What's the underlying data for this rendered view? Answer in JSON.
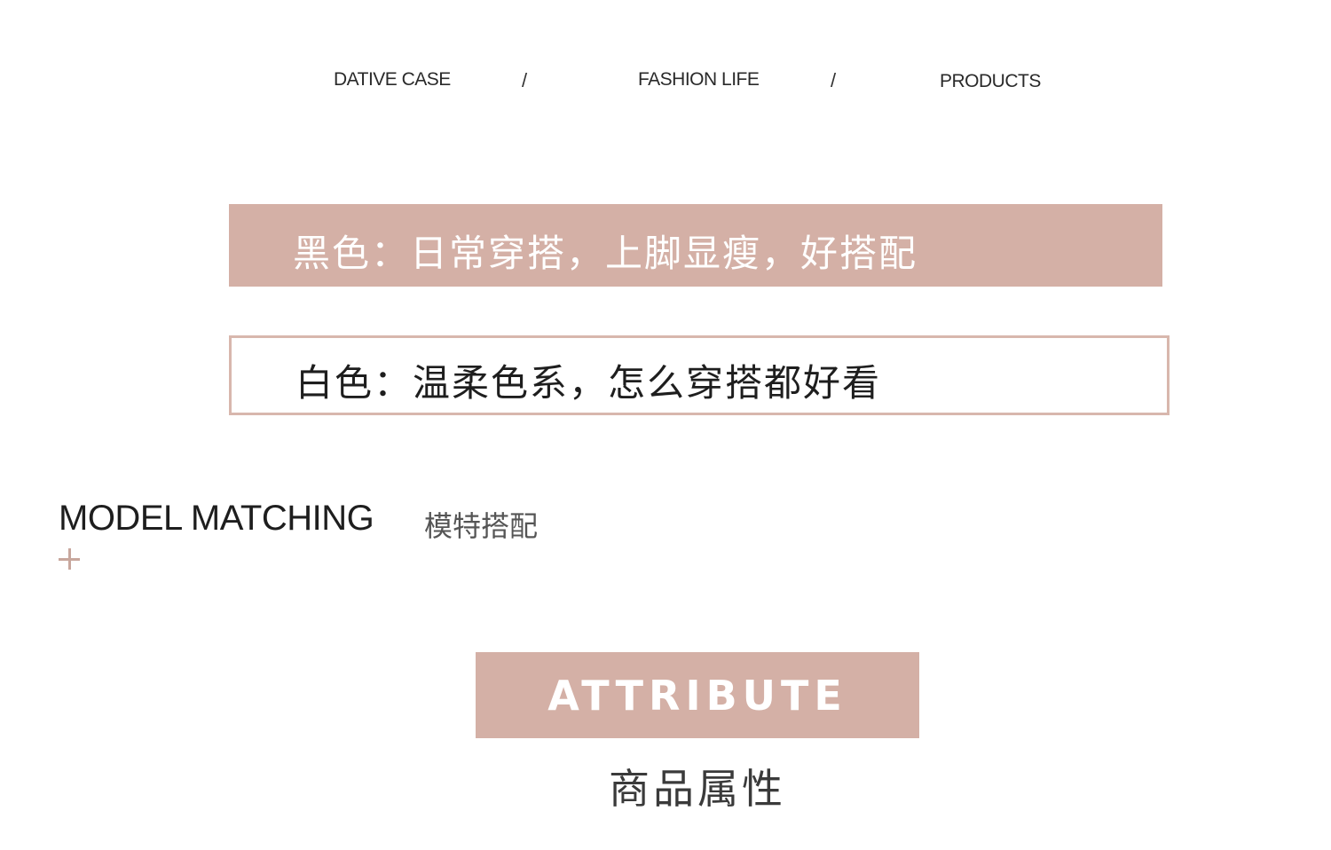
{
  "nav": {
    "items": [
      "DATIVE CASE",
      "FASHION LIFE",
      "PRODUCTS"
    ],
    "separator": "/"
  },
  "banners": {
    "black": "黑色：日常穿搭，上脚显瘦，好搭配",
    "white": "白色：温柔色系，怎么穿搭都好看"
  },
  "section": {
    "title": "MODEL MATCHING",
    "subtitle": "模特搭配",
    "icon": "plus-icon"
  },
  "attribute": {
    "label": "ATTRIBUTE",
    "subtitle": "商品属性"
  },
  "colors": {
    "accent": "#d4b0a6",
    "outline": "#d8b7ad",
    "plus": "#c8a79d",
    "text": "#1e1e1e"
  }
}
